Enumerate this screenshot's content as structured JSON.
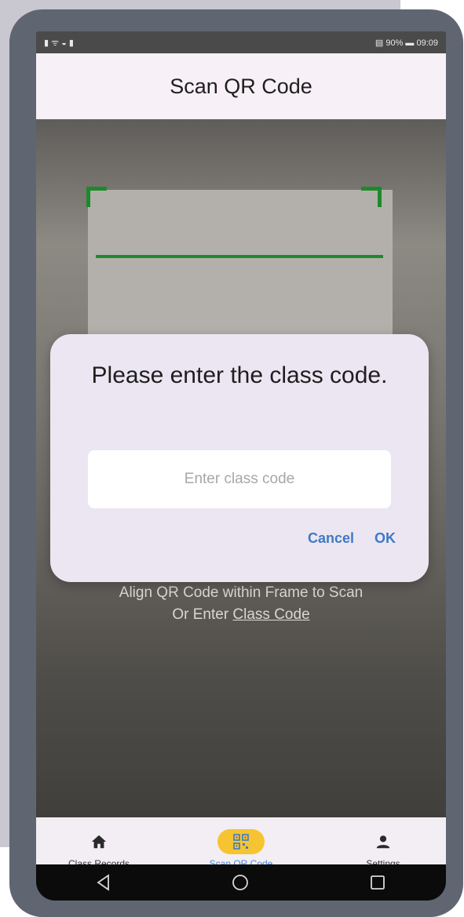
{
  "statusbar": {
    "left": "▮ ᯤ ◒ ▮",
    "right": "▤ 90% ▬ 09:09"
  },
  "header": {
    "title": "Scan QR Code"
  },
  "camera": {
    "hint_line1": "Align QR Code within Frame to Scan",
    "hint_prefix": "Or Enter ",
    "hint_link": "Class Code"
  },
  "dialog": {
    "title": "Please enter the class code.",
    "input_placeholder": "Enter class code",
    "input_value": "",
    "cancel_label": "Cancel",
    "ok_label": "OK"
  },
  "bottom_nav": {
    "items": [
      {
        "label": "Class Records",
        "icon": "home-icon",
        "active": false
      },
      {
        "label": "Scan QR Code",
        "icon": "qr-code-icon",
        "active": true
      },
      {
        "label": "Settings",
        "icon": "person-icon",
        "active": false
      }
    ]
  },
  "system_nav": {
    "back": "◁",
    "home": "○",
    "recents": "□"
  },
  "colors": {
    "accent": "#f6c431",
    "link": "#3f79c5",
    "scan_frame": "#1c8a2a"
  }
}
